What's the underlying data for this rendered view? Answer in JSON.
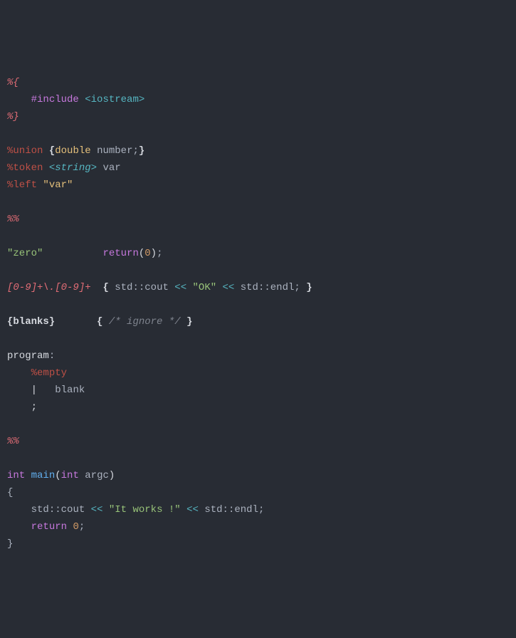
{
  "line1": {
    "open": "%{"
  },
  "line2": {
    "indent": "    ",
    "include": "#include",
    "sp": " ",
    "hdr": "<iostream>"
  },
  "line3": {
    "close": "%}"
  },
  "line4": "",
  "line5": {
    "union": "%union",
    "sp1": " ",
    "lb": "{",
    "type": "double",
    "sp2": " ",
    "name": "number",
    "semi": ";",
    "rb": "}"
  },
  "line6": {
    "token": "%token",
    "sp1": " ",
    "typ": "<string>",
    "sp2": " ",
    "name": "var"
  },
  "line7": {
    "left": "%left",
    "sp1": " ",
    "q": "\"var\""
  },
  "line8": "",
  "line9": {
    "pp": "%%"
  },
  "line10": "",
  "line11": {
    "str": "\"zero\"",
    "sp": "          ",
    "ret": "return",
    "lp": "(",
    "num": "0",
    "rp": ")",
    "semi": ";"
  },
  "line12": "",
  "line13": {
    "rx": "[0-9]+\\.[0-9]+",
    "sp1": "  ",
    "lb": "{",
    "sp2": " ",
    "ns": "std",
    "c1": "::",
    "cout": "cout",
    "sp3": " ",
    "lt1": "<<",
    "sp4": " ",
    "ok": "\"OK\"",
    "sp5": " ",
    "lt2": "<<",
    "sp6": " ",
    "ns2": "std",
    "c2": "::",
    "endl": "endl",
    "semi": ";",
    "sp7": " ",
    "rb": "}"
  },
  "line14": "",
  "line15": {
    "bl": "{blanks}",
    "sp1": "       ",
    "lb": "{",
    "sp2": " ",
    "cm": "/* ignore */",
    "sp3": " ",
    "rb": "}"
  },
  "line16": "",
  "line17": {
    "prog": "program",
    "colon": ":"
  },
  "line18": {
    "indent": "    ",
    "empty": "%empty"
  },
  "line19": {
    "indent": "    ",
    "pipe": "|",
    "sp": "   ",
    "blank": "blank"
  },
  "line20": {
    "indent": "    ",
    "semi": ";"
  },
  "line21": "",
  "line22": {
    "pp": "%%"
  },
  "line23": "",
  "line24": {
    "int": "int",
    "sp1": " ",
    "main": "main",
    "lp": "(",
    "int2": "int",
    "sp2": " ",
    "argc": "argc",
    "rp": ")"
  },
  "line25": {
    "lb": "{"
  },
  "line26": {
    "indent": "    ",
    "ns": "std",
    "c1": "::",
    "cout": "cout",
    "sp1": " ",
    "lt1": "<<",
    "sp2": " ",
    "str": "\"It works !\"",
    "sp3": " ",
    "lt2": "<<",
    "sp4": " ",
    "ns2": "std",
    "c2": "::",
    "endl": "endl",
    "semi": ";"
  },
  "line27": {
    "indent": "    ",
    "ret": "return",
    "sp": " ",
    "num": "0",
    "semi": ";"
  },
  "line28": {
    "rb": "}"
  }
}
